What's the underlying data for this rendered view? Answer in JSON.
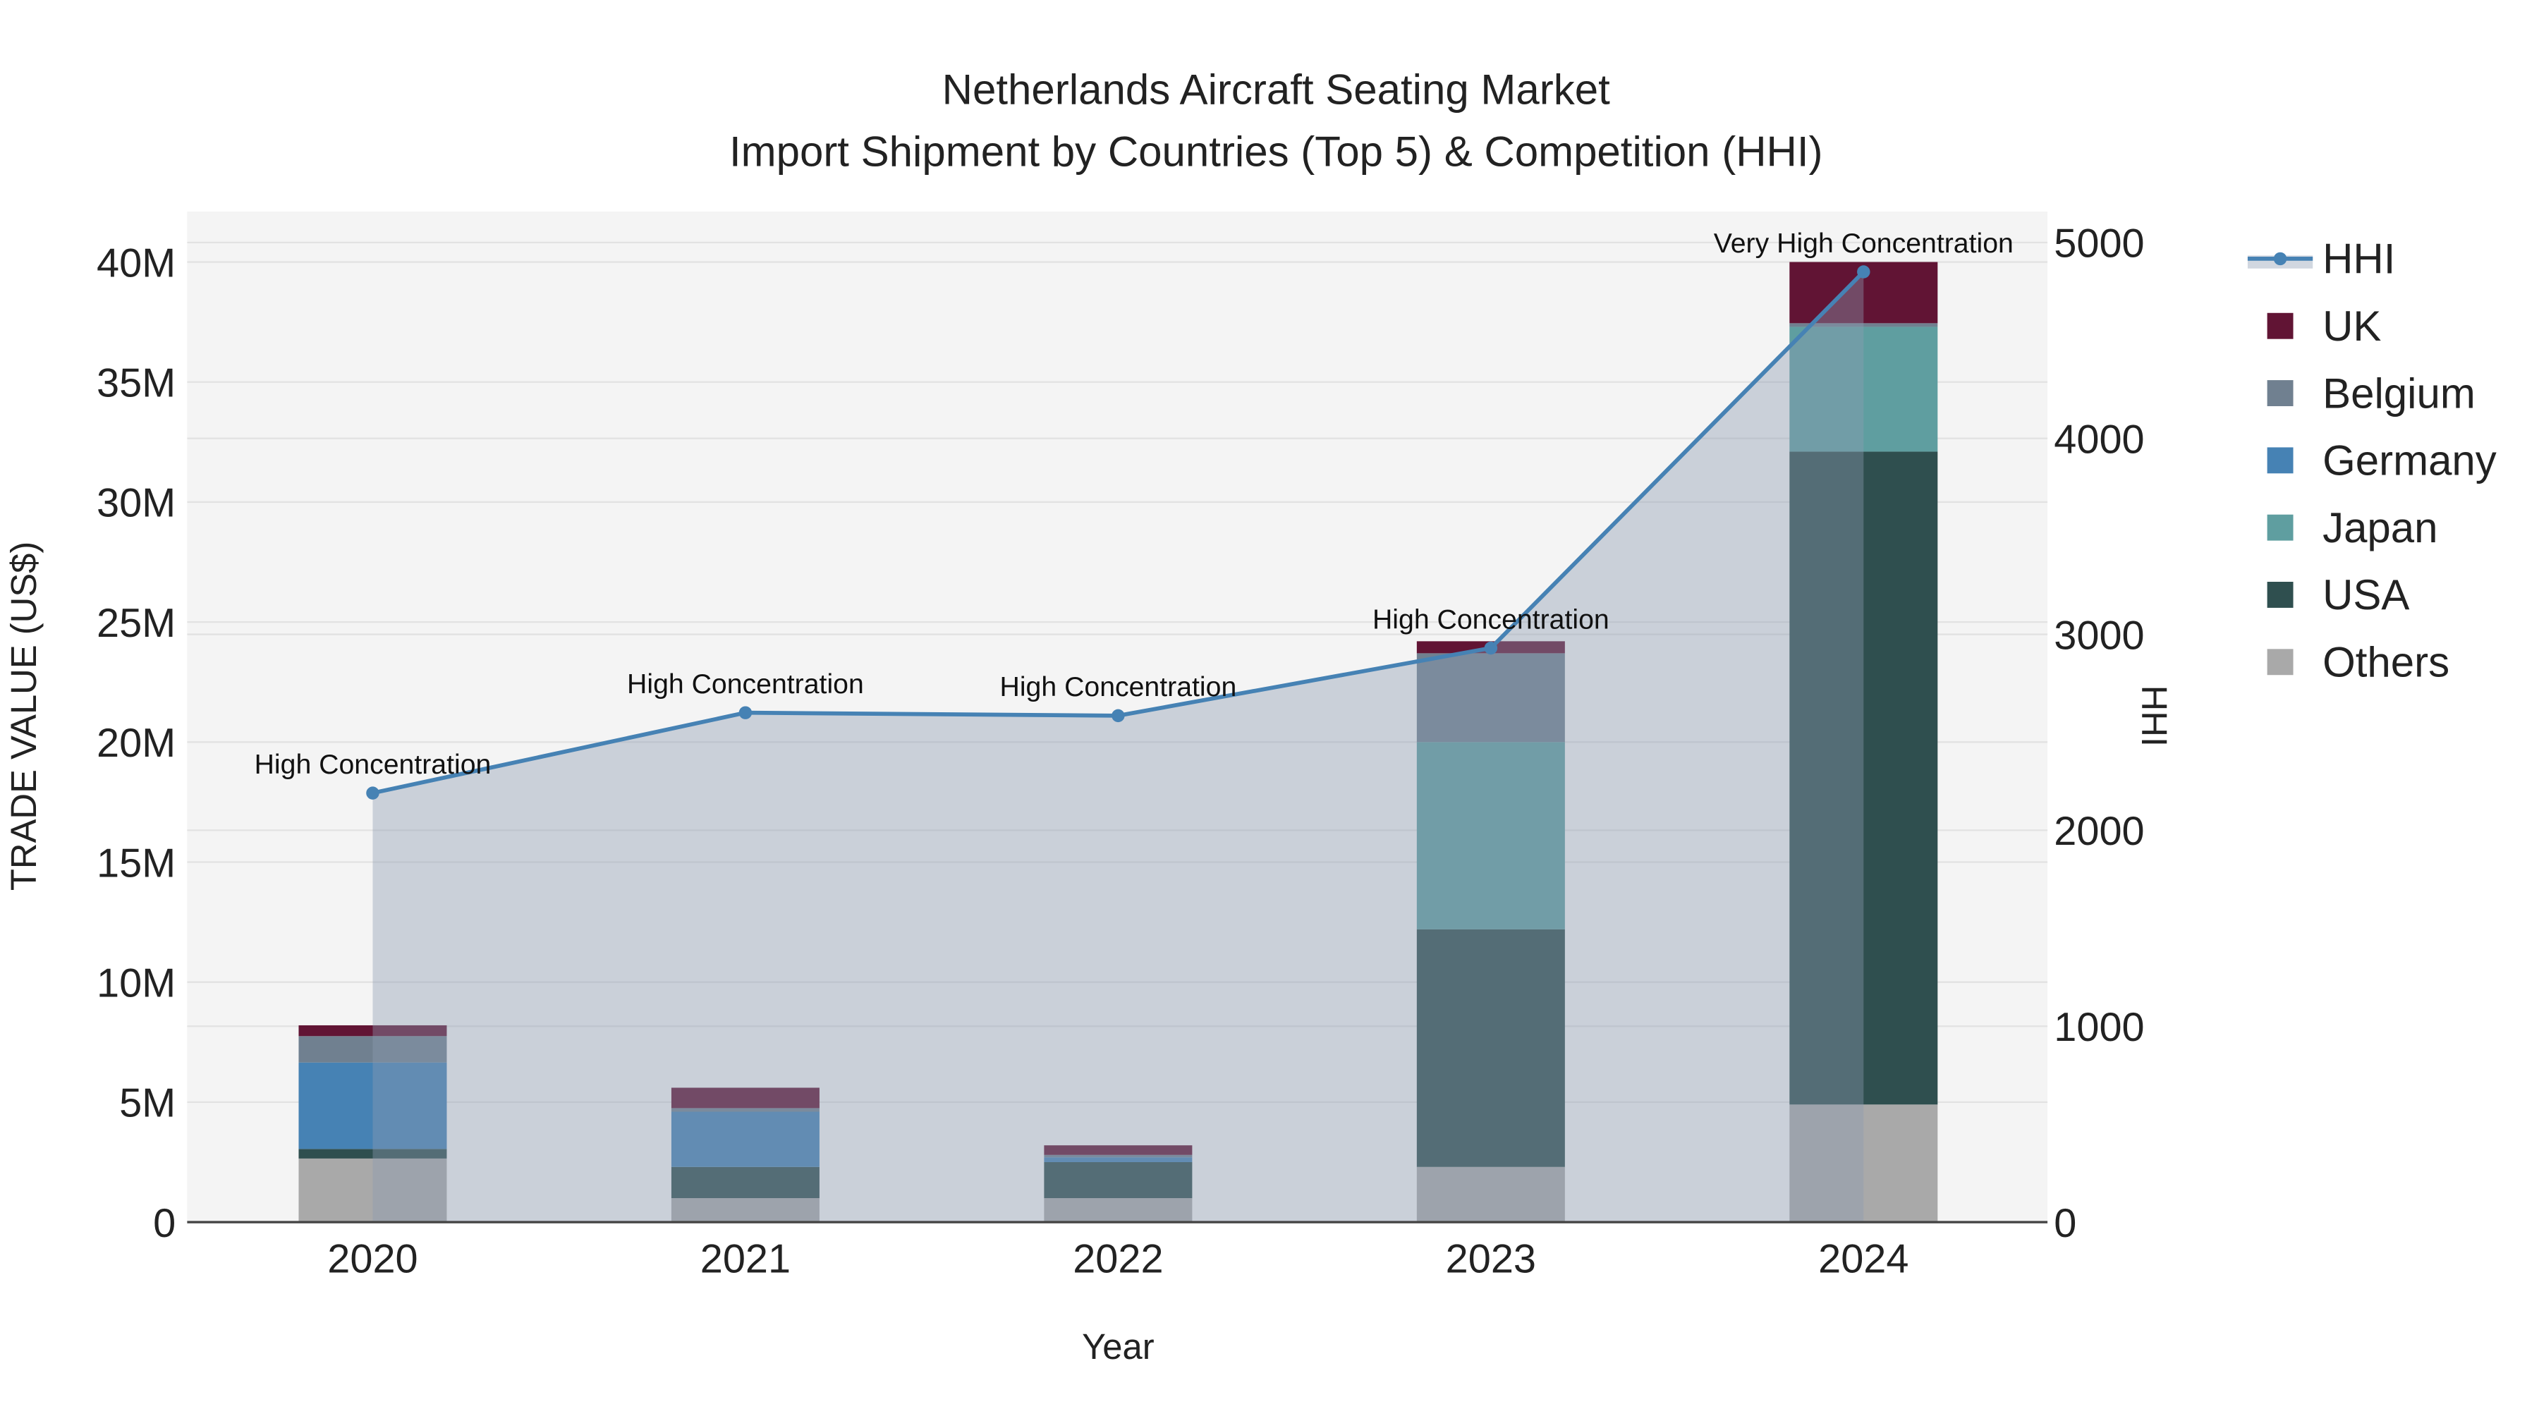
{
  "chart_data": {
    "type": "bar",
    "title": "Netherlands Aircraft Seating Market",
    "subtitle": "Import Shipment by Countries (Top 5) & Competition (HHI)",
    "xlabel": "Year",
    "ylabel": "TRADE VALUE (US$)",
    "y2label": "HHI",
    "categories": [
      "2020",
      "2021",
      "2022",
      "2023",
      "2024"
    ],
    "ylim": [
      0,
      42000000
    ],
    "y2lim": [
      0,
      5250
    ],
    "yticks": [
      0,
      5000000,
      10000000,
      15000000,
      20000000,
      25000000,
      30000000,
      35000000,
      40000000
    ],
    "ytick_labels": [
      "0",
      "5M",
      "10M",
      "15M",
      "20M",
      "25M",
      "30M",
      "35M",
      "40M"
    ],
    "y2ticks": [
      0,
      1000,
      2000,
      3000,
      4000,
      5000
    ],
    "y2tick_labels": [
      "0",
      "1000",
      "2000",
      "3000",
      "4000",
      "5000"
    ],
    "stacked": true,
    "grid": true,
    "legend_position": "right",
    "series": [
      {
        "name": "Others",
        "color": "#A9A9A9",
        "values": [
          2650000,
          1000000,
          1000000,
          2300000,
          4900000
        ]
      },
      {
        "name": "USA",
        "color": "#2F4F4F",
        "values": [
          400000,
          1300000,
          1500000,
          9900000,
          27200000
        ]
      },
      {
        "name": "Japan",
        "color": "#5F9EA0",
        "values": [
          0,
          0,
          0,
          7800000,
          5200000
        ]
      },
      {
        "name": "Germany",
        "color": "#4682B4",
        "values": [
          3600000,
          2300000,
          200000,
          0,
          0
        ]
      },
      {
        "name": "Belgium",
        "color": "#708090",
        "values": [
          1100000,
          150000,
          100000,
          3700000,
          150000
        ]
      },
      {
        "name": "UK",
        "color": "#611434",
        "values": [
          450000,
          850000,
          400000,
          500000,
          2550000
        ]
      }
    ],
    "line": {
      "name": "HHI",
      "color": "#4682B4",
      "values": [
        2190,
        2600,
        2585,
        2930,
        4850
      ],
      "annotations": [
        "High Concentration",
        "High Concentration",
        "High Concentration",
        "High Concentration",
        "Very High Concentration"
      ]
    },
    "legend_order": [
      "HHI",
      "UK",
      "Belgium",
      "Germany",
      "Japan",
      "USA",
      "Others"
    ]
  }
}
